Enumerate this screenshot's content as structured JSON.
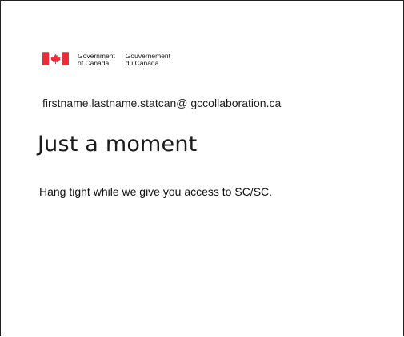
{
  "branding": {
    "icon": "canada-flag-icon",
    "flag_red": "#eb2d37",
    "wordmark_en_line1": "Government",
    "wordmark_en_line2": "of Canada",
    "wordmark_fr_line1": "Gouvernement",
    "wordmark_fr_line2": "du Canada"
  },
  "account": {
    "email": "firstname.lastname.statcan@ gccollaboration.ca"
  },
  "main": {
    "title": "Just a moment",
    "message": "Hang tight while we give you access to SC/SC."
  }
}
